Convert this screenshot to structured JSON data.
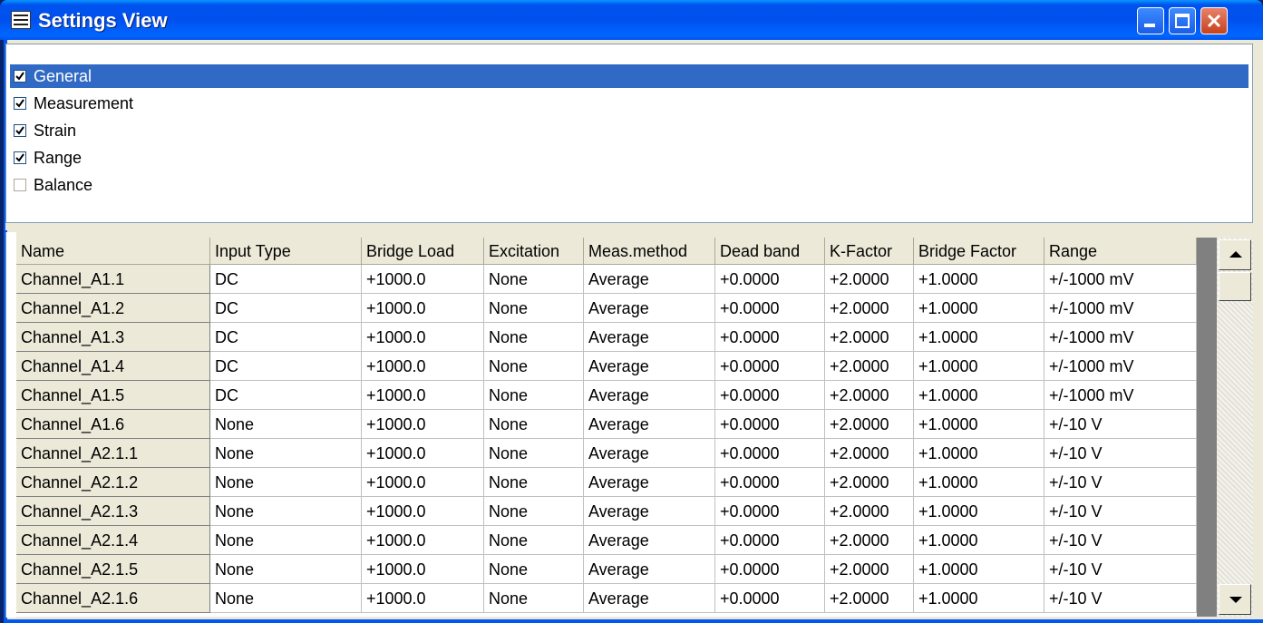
{
  "window": {
    "title": "Settings View",
    "title_icon": "grid-app-icon",
    "controls": [
      "minimize-icon",
      "maximize-icon",
      "close-icon"
    ]
  },
  "tree": {
    "items": [
      {
        "label": "General",
        "checked": true,
        "selected": true
      },
      {
        "label": "Measurement",
        "checked": true,
        "selected": false
      },
      {
        "label": "Strain",
        "checked": true,
        "selected": false
      },
      {
        "label": "Range",
        "checked": true,
        "selected": false
      },
      {
        "label": "Balance",
        "checked": false,
        "selected": false
      }
    ]
  },
  "table": {
    "columns": [
      "Name",
      "Input Type",
      "Bridge Load",
      "Excitation",
      "Meas.method",
      "Dead band",
      "K-Factor",
      "Bridge Factor",
      "Range"
    ],
    "rows": [
      [
        "Channel_A1.1",
        "DC",
        "+1000.0",
        "None",
        "Average",
        "+0.0000",
        "+2.0000",
        "+1.0000",
        "+/-1000 mV"
      ],
      [
        "Channel_A1.2",
        "DC",
        "+1000.0",
        "None",
        "Average",
        "+0.0000",
        "+2.0000",
        "+1.0000",
        "+/-1000 mV"
      ],
      [
        "Channel_A1.3",
        "DC",
        "+1000.0",
        "None",
        "Average",
        "+0.0000",
        "+2.0000",
        "+1.0000",
        "+/-1000 mV"
      ],
      [
        "Channel_A1.4",
        "DC",
        "+1000.0",
        "None",
        "Average",
        "+0.0000",
        "+2.0000",
        "+1.0000",
        "+/-1000 mV"
      ],
      [
        "Channel_A1.5",
        "DC",
        "+1000.0",
        "None",
        "Average",
        "+0.0000",
        "+2.0000",
        "+1.0000",
        "+/-1000 mV"
      ],
      [
        "Channel_A1.6",
        "None",
        "+1000.0",
        "None",
        "Average",
        "+0.0000",
        "+2.0000",
        "+1.0000",
        "+/-10 V"
      ],
      [
        "Channel_A2.1.1",
        "None",
        "+1000.0",
        "None",
        "Average",
        "+0.0000",
        "+2.0000",
        "+1.0000",
        "+/-10 V"
      ],
      [
        "Channel_A2.1.2",
        "None",
        "+1000.0",
        "None",
        "Average",
        "+0.0000",
        "+2.0000",
        "+1.0000",
        "+/-10 V"
      ],
      [
        "Channel_A2.1.3",
        "None",
        "+1000.0",
        "None",
        "Average",
        "+0.0000",
        "+2.0000",
        "+1.0000",
        "+/-10 V"
      ],
      [
        "Channel_A2.1.4",
        "None",
        "+1000.0",
        "None",
        "Average",
        "+0.0000",
        "+2.0000",
        "+1.0000",
        "+/-10 V"
      ],
      [
        "Channel_A2.1.5",
        "None",
        "+1000.0",
        "None",
        "Average",
        "+0.0000",
        "+2.0000",
        "+1.0000",
        "+/-10 V"
      ],
      [
        "Channel_A2.1.6",
        "None",
        "+1000.0",
        "None",
        "Average",
        "+0.0000",
        "+2.0000",
        "+1.0000",
        "+/-10 V"
      ]
    ]
  },
  "scrollbar": {
    "up": "scroll-up-arrow-icon",
    "down": "scroll-down-arrow-icon"
  },
  "colors": {
    "title_blue": "#0053EE",
    "selection": "#316AC5",
    "face": "#ECE9D8"
  }
}
